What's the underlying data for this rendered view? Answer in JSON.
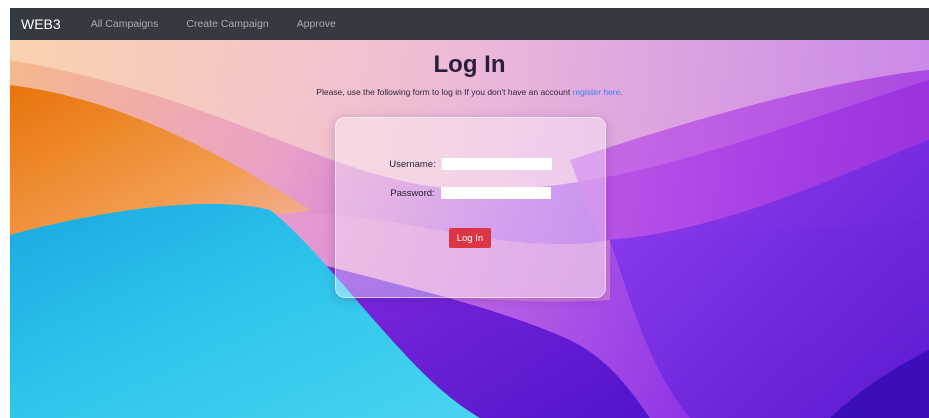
{
  "navbar": {
    "brand": "WEB3",
    "links": [
      "All Campaigns",
      "Create Campaign",
      "Approve"
    ]
  },
  "page": {
    "title": "Log In",
    "subtitle_prefix": "Please, use the following form to log in If you don't have an account",
    "register_link": "register here",
    "subtitle_suffix": "."
  },
  "form": {
    "username_label": "Username:",
    "username_value": "",
    "password_label": "Password:",
    "password_value": "",
    "submit_label": "Log In"
  },
  "colors": {
    "navbar_bg": "#343a40",
    "button_bg": "#dc3545",
    "link": "#3b82f6"
  }
}
